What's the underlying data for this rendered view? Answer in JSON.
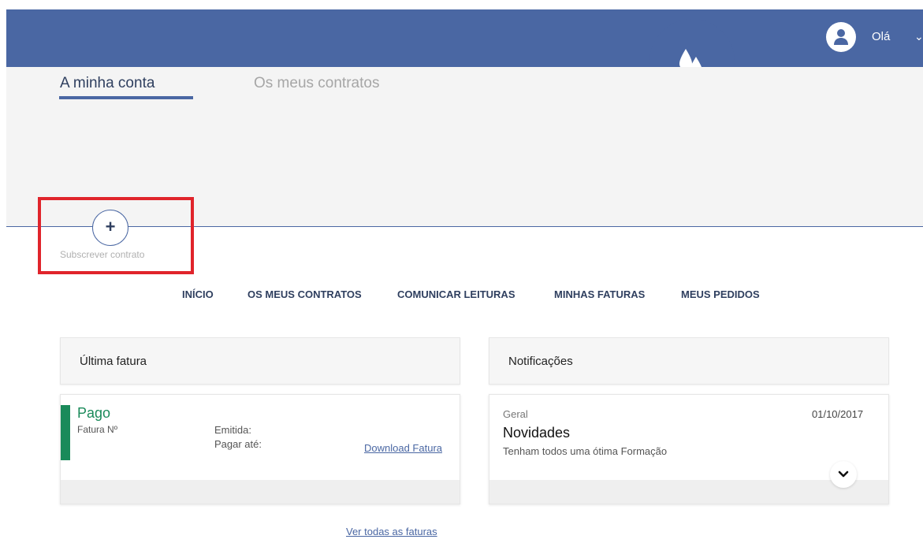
{
  "header": {
    "greeting": "Olá",
    "avatar_icon": "user-icon",
    "logo_icon": "water-drops-icon",
    "brand_color": "#4a67a3"
  },
  "tabs": {
    "account": "A minha conta",
    "contracts": "Os meus contratos"
  },
  "subscribe": {
    "icon": "+",
    "label": "Subscrever contrato",
    "highlight_color": "#e0242b"
  },
  "nav": {
    "items": [
      "INÍCIO",
      "OS MEUS CONTRATOS",
      "COMUNICAR LEITURAS",
      "MINHAS FATURAS",
      "MEUS PEDIDOS"
    ]
  },
  "last_invoice": {
    "title": "Última fatura",
    "status": "Pago",
    "status_color": "#1a8a5a",
    "invoice_number_label": "Fatura Nº",
    "issued_label": "Emitida:",
    "due_label": "Pagar até:",
    "download_link": "Download Fatura",
    "view_all_link": "Ver todas as faturas"
  },
  "notifications": {
    "title": "Notificações",
    "category": "Geral",
    "date": "01/10/2017",
    "headline": "Novidades",
    "message": "Tenham todos uma ótima Formação"
  }
}
